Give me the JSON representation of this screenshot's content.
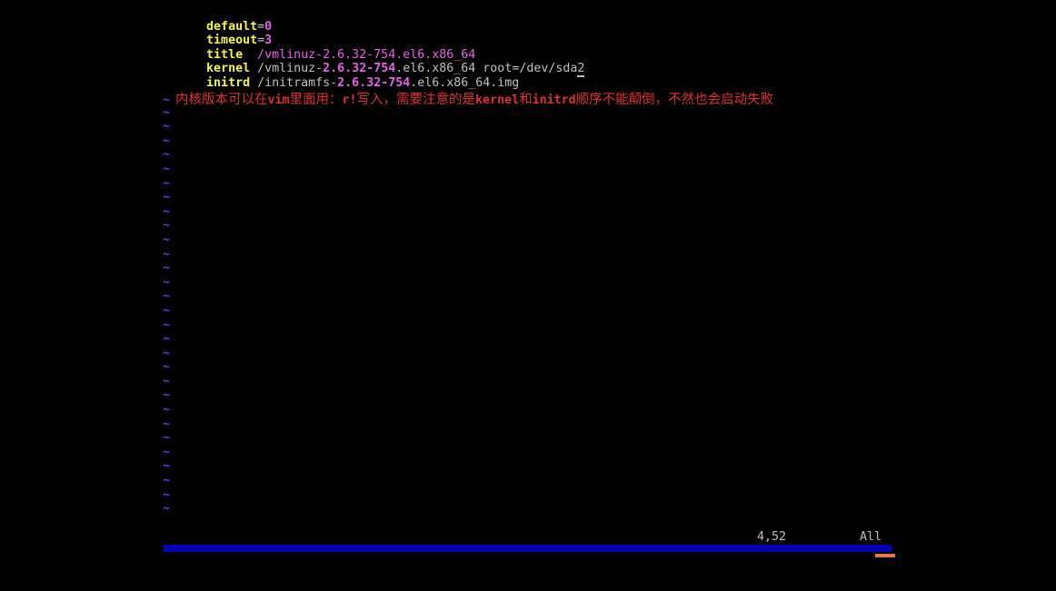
{
  "editor": {
    "name": "vim",
    "background": "#000000",
    "colors": {
      "keyword": "#f5f54a",
      "number": "#e860e8",
      "string": "#e860e8",
      "path": "#c0c0c0",
      "comment": "#e03030",
      "tilde": "#4a4ae0",
      "status_text": "#c0c0c0",
      "bar": "#0000b4",
      "accent": "#e07a40"
    },
    "lines": [
      {
        "id": "line-default",
        "segments": [
          {
            "text": "default",
            "role": "keyword"
          },
          {
            "text": "=",
            "role": "operator"
          },
          {
            "text": "0",
            "role": "number"
          }
        ]
      },
      {
        "id": "line-timeout",
        "segments": [
          {
            "text": "timeout",
            "role": "keyword"
          },
          {
            "text": "=",
            "role": "operator"
          },
          {
            "text": "3",
            "role": "number"
          }
        ]
      },
      {
        "id": "line-title",
        "segments": [
          {
            "text": "title",
            "role": "keyword"
          },
          {
            "text": "  ",
            "role": "space"
          },
          {
            "text": "/vmlinuz-2.6.32-754.el6.x86_64",
            "role": "string"
          }
        ]
      },
      {
        "id": "line-kernel",
        "segments": [
          {
            "text": "kernel",
            "role": "keyword"
          },
          {
            "text": " ",
            "role": "space"
          },
          {
            "text": "/vmlinuz-",
            "role": "path"
          },
          {
            "text": "2.6.32-754",
            "role": "number"
          },
          {
            "text": ".el6.x86_64 root=/dev/sda",
            "role": "path"
          },
          {
            "text": "2",
            "role": "cursor"
          }
        ]
      },
      {
        "id": "line-initrd",
        "segments": [
          {
            "text": "initrd",
            "role": "keyword"
          },
          {
            "text": " ",
            "role": "space"
          },
          {
            "text": "/initramfs-",
            "role": "path"
          },
          {
            "text": "2.6.32-754",
            "role": "number"
          },
          {
            "text": ".el6.x86_64.img",
            "role": "path"
          }
        ]
      }
    ],
    "comment": {
      "tilde": "~",
      "parts": [
        {
          "text": "内核版本可以在",
          "mono": false
        },
        {
          "text": "vim",
          "mono": true
        },
        {
          "text": "里面用：",
          "mono": false
        },
        {
          "text": "r!",
          "mono": true
        },
        {
          "text": "写入，需要注意的是",
          "mono": false
        },
        {
          "text": "kernel",
          "mono": true
        },
        {
          "text": "和",
          "mono": false
        },
        {
          "text": "initrd",
          "mono": true
        },
        {
          "text": "顺序不能颠倒，不然也会启动失败",
          "mono": false
        }
      ],
      "full_text": "内核版本可以在vim里面用：r!写入，需要注意的是kernel和initrd顺序不能颠倒，不然也会启动失败"
    },
    "tilde_char": "~",
    "tilde_count": 30,
    "status": {
      "position": "4,52",
      "scroll": "All"
    }
  }
}
